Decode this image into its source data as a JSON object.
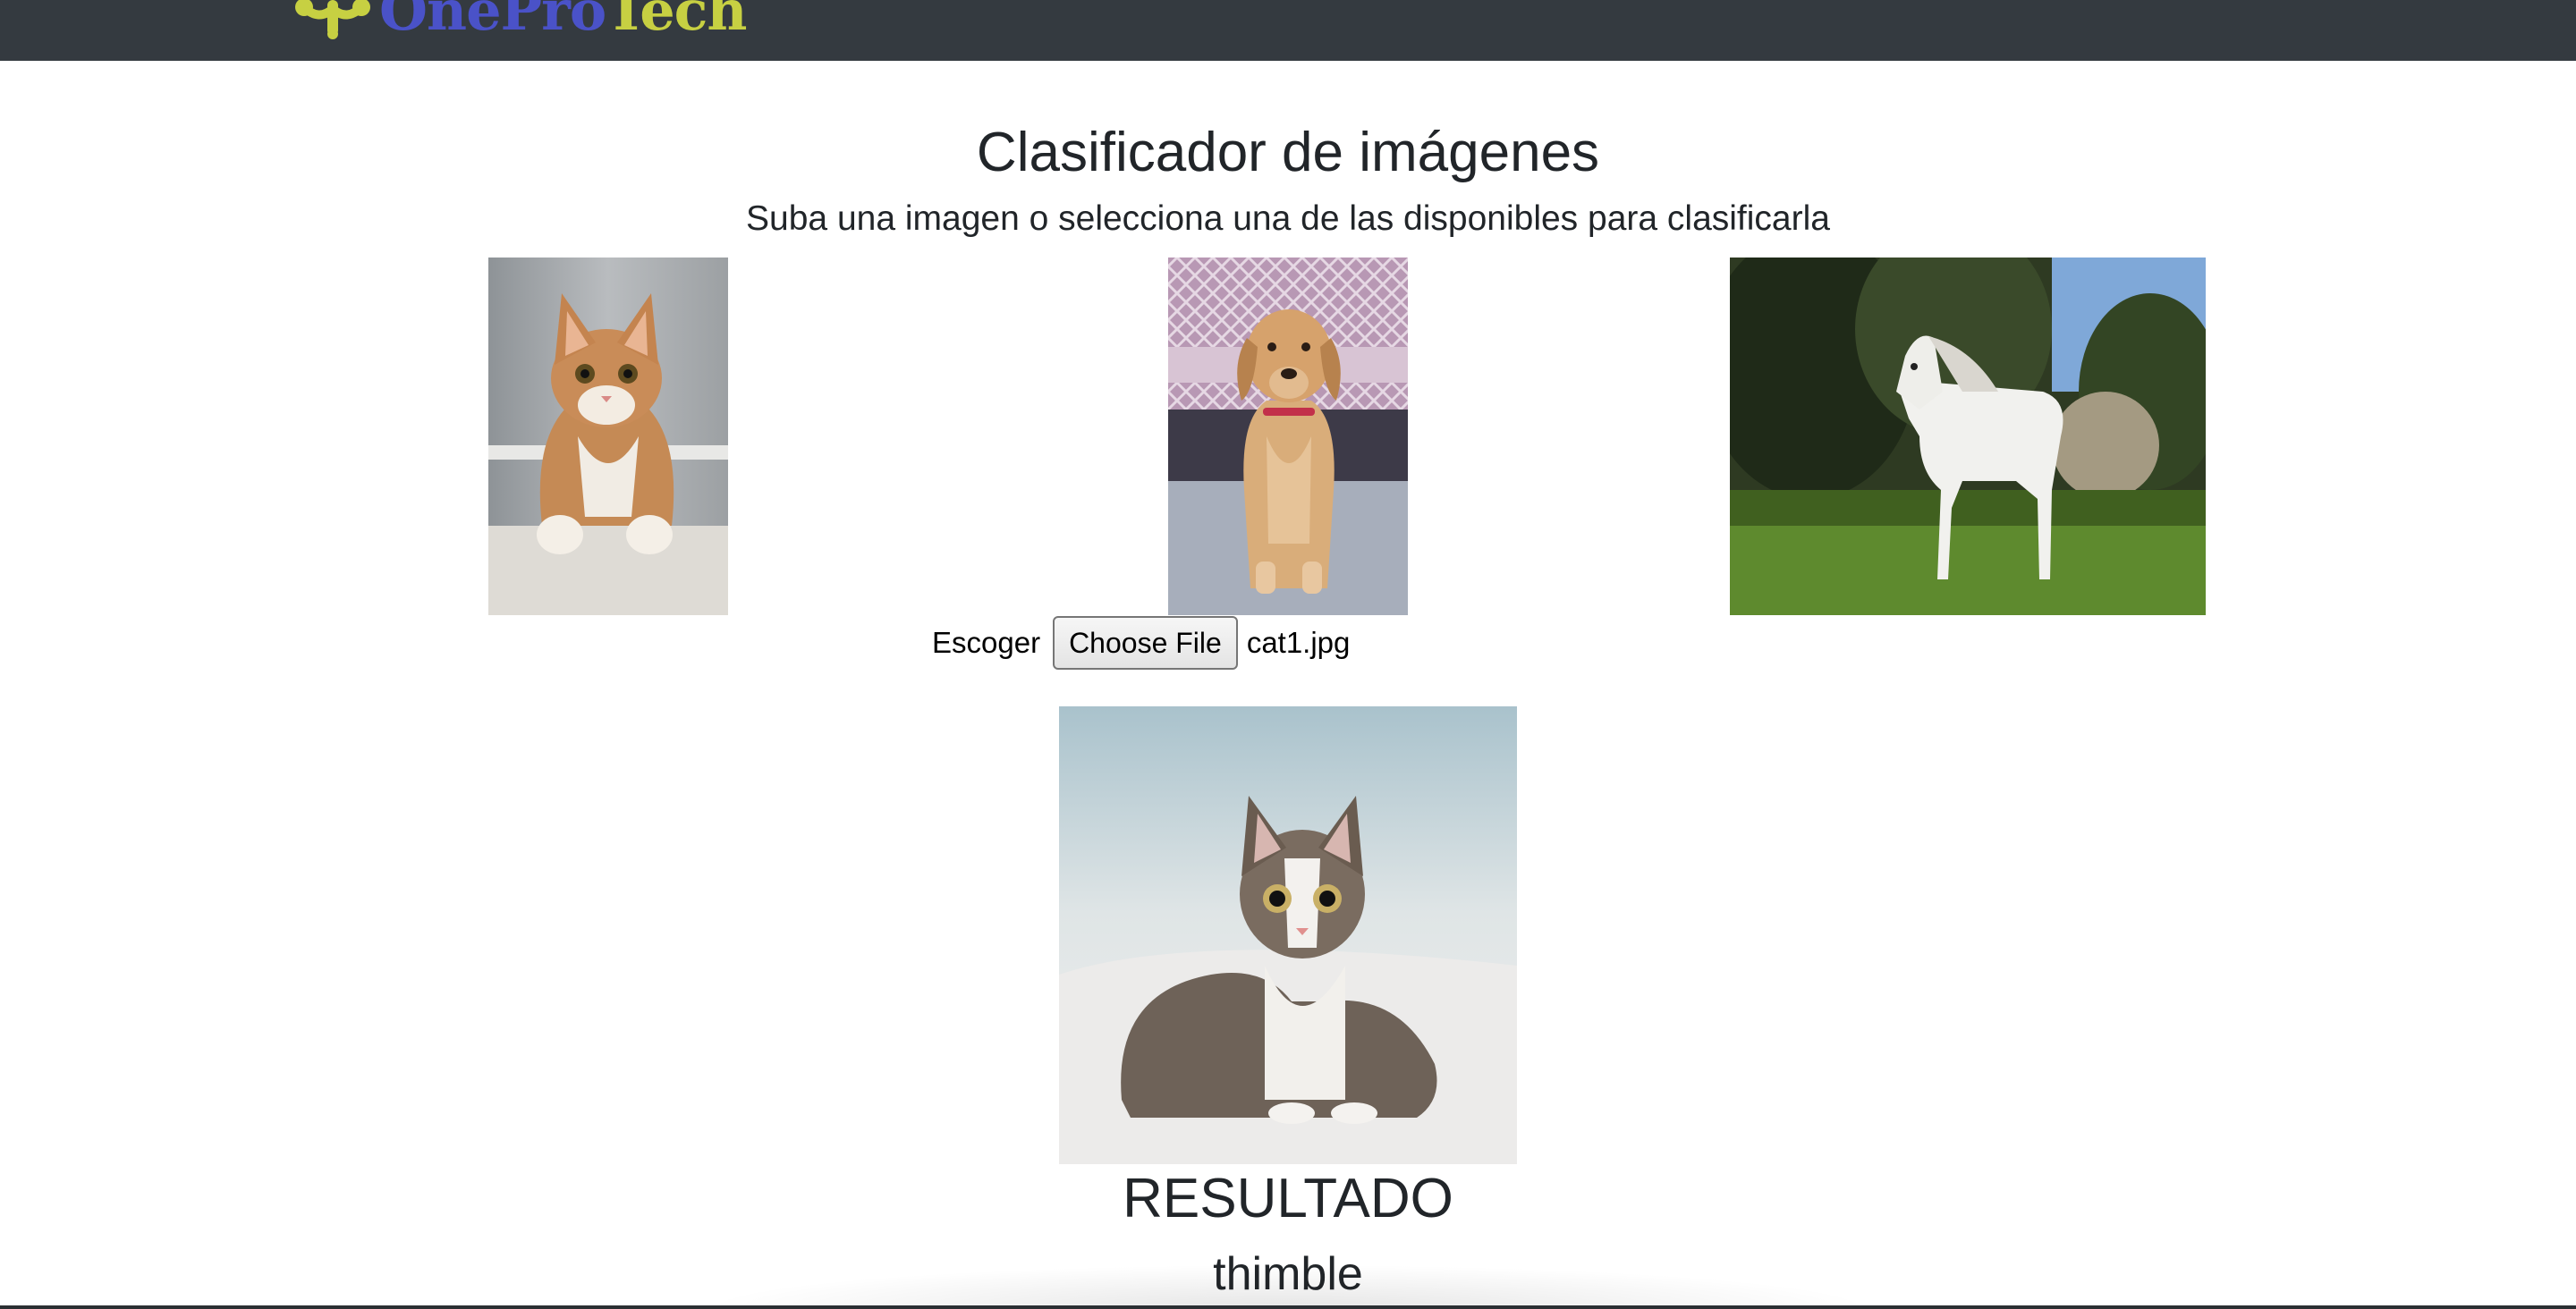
{
  "navbar": {
    "brand_one": "OnePro",
    "brand_tech": "Tech",
    "colors": {
      "background": "#343a40",
      "one": "#4a52c8",
      "tech": "#c7d042"
    }
  },
  "main": {
    "title": "Clasificador de imágenes",
    "subtitle": "Suba una imagen o selecciona una de las disponibles para clasificarla",
    "samples": [
      {
        "icon": "cat-photo"
      },
      {
        "icon": "dog-photo"
      },
      {
        "icon": "horse-photo"
      }
    ],
    "upload": {
      "label": "Escoger",
      "button": "Choose File",
      "file_name": "cat1.jpg"
    },
    "preview": {
      "icon": "uploaded-cat-photo"
    },
    "result": {
      "heading": "RESULTADO",
      "value": "thimble"
    }
  }
}
